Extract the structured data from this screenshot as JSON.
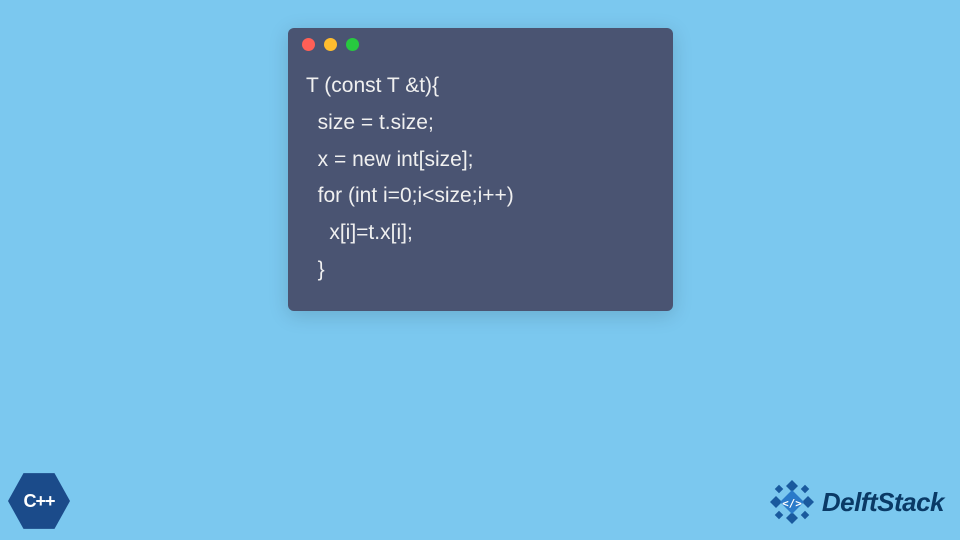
{
  "code": {
    "lines": [
      "T (const T &t){",
      "  size = t.size;",
      "  x = new int[size];",
      "  for (int i=0;i<size;i++)",
      "    x[i]=t.x[i];",
      "  }"
    ]
  },
  "badge": {
    "label": "C++"
  },
  "brand": {
    "name": "DelftStack"
  },
  "colors": {
    "background": "#7bc8ef",
    "window": "#4a5472",
    "badge": "#1b4b8a",
    "brandText": "#0a3a66"
  }
}
